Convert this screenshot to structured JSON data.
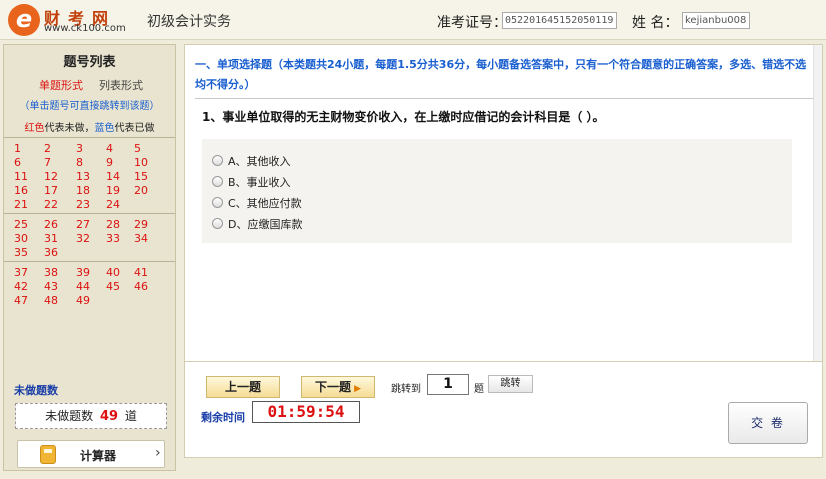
{
  "header": {
    "logo_name": "财考网",
    "logo_url": "www.ck100.com",
    "exam_title": "初级会计实务",
    "ticket_label": "准考证号：",
    "ticket_value": "052201645152050119",
    "name_label": "姓  名：",
    "name_value": "kejianbu008"
  },
  "sidebar": {
    "title": "题号列表",
    "tab_single": "单题形式",
    "tab_list": "列表形式",
    "hint": "（单击题号可直接跳转到该题）",
    "legend_red": "红色",
    "legend_mid": "代表未做，",
    "legend_blue": "蓝色",
    "legend_end": "代表已做",
    "question_groups": [
      [
        1,
        2,
        3,
        4,
        5,
        6,
        7,
        8,
        9,
        10,
        11,
        12,
        13,
        14,
        15,
        16,
        17,
        18,
        19,
        20,
        21,
        22,
        23,
        24
      ],
      [
        25,
        26,
        27,
        28,
        29,
        30,
        31,
        32,
        33,
        34,
        35,
        36
      ],
      [
        37,
        38,
        39,
        40,
        41,
        42,
        43,
        44,
        45,
        46,
        47,
        48,
        49
      ]
    ],
    "undone_title": "未做题数",
    "undone_prefix": "未做题数",
    "undone_count": "49",
    "undone_suffix": "道",
    "calc_label": "计算器",
    "calc_arrow": "›"
  },
  "question": {
    "section_title": "一、单项选择题（本类题共24小题，每题1.5分共36分，每小题备选答案中，只有一个符合题意的正确答案，多选、错选不选均不得分。）",
    "text": "1、事业单位取得的无主财物变价收入，在上缴时应借记的会计科目是（    ）。",
    "options": [
      "A、其他收入",
      "B、事业收入",
      "C、其他应付款",
      "D、应缴国库款"
    ]
  },
  "footer": {
    "prev_label": "上一题",
    "next_label": "下一题",
    "next_icon": "play-triangle-icon",
    "jump_label": "跳转到",
    "jump_value": "1",
    "jump_unit": "题",
    "jump_button": "跳转",
    "time_label": "剩余时间",
    "timer": "01:59:54",
    "submit_label": "交 卷"
  },
  "colors": {
    "undone": "#dd1111",
    "done": "#1a5fd0",
    "accent": "#e8641c"
  }
}
